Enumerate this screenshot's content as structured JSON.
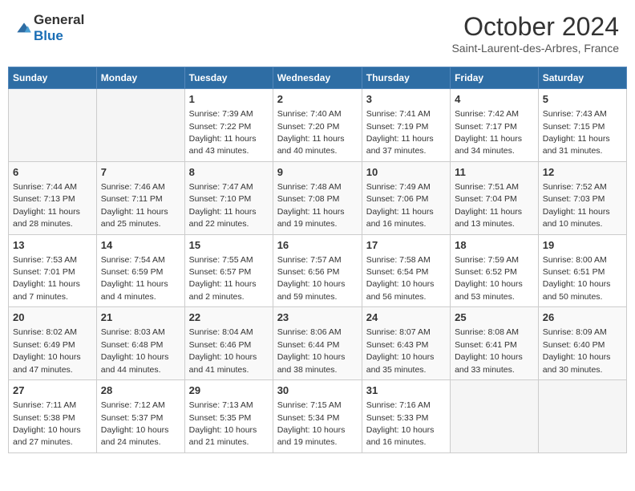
{
  "header": {
    "logo_general": "General",
    "logo_blue": "Blue",
    "month_title": "October 2024",
    "location": "Saint-Laurent-des-Arbres, France"
  },
  "weekdays": [
    "Sunday",
    "Monday",
    "Tuesday",
    "Wednesday",
    "Thursday",
    "Friday",
    "Saturday"
  ],
  "weeks": [
    [
      {
        "day": "",
        "empty": true
      },
      {
        "day": "",
        "empty": true
      },
      {
        "day": "1",
        "sunrise": "7:39 AM",
        "sunset": "7:22 PM",
        "daylight": "11 hours and 43 minutes."
      },
      {
        "day": "2",
        "sunrise": "7:40 AM",
        "sunset": "7:20 PM",
        "daylight": "11 hours and 40 minutes."
      },
      {
        "day": "3",
        "sunrise": "7:41 AM",
        "sunset": "7:19 PM",
        "daylight": "11 hours and 37 minutes."
      },
      {
        "day": "4",
        "sunrise": "7:42 AM",
        "sunset": "7:17 PM",
        "daylight": "11 hours and 34 minutes."
      },
      {
        "day": "5",
        "sunrise": "7:43 AM",
        "sunset": "7:15 PM",
        "daylight": "11 hours and 31 minutes."
      }
    ],
    [
      {
        "day": "6",
        "sunrise": "7:44 AM",
        "sunset": "7:13 PM",
        "daylight": "11 hours and 28 minutes."
      },
      {
        "day": "7",
        "sunrise": "7:46 AM",
        "sunset": "7:11 PM",
        "daylight": "11 hours and 25 minutes."
      },
      {
        "day": "8",
        "sunrise": "7:47 AM",
        "sunset": "7:10 PM",
        "daylight": "11 hours and 22 minutes."
      },
      {
        "day": "9",
        "sunrise": "7:48 AM",
        "sunset": "7:08 PM",
        "daylight": "11 hours and 19 minutes."
      },
      {
        "day": "10",
        "sunrise": "7:49 AM",
        "sunset": "7:06 PM",
        "daylight": "11 hours and 16 minutes."
      },
      {
        "day": "11",
        "sunrise": "7:51 AM",
        "sunset": "7:04 PM",
        "daylight": "11 hours and 13 minutes."
      },
      {
        "day": "12",
        "sunrise": "7:52 AM",
        "sunset": "7:03 PM",
        "daylight": "11 hours and 10 minutes."
      }
    ],
    [
      {
        "day": "13",
        "sunrise": "7:53 AM",
        "sunset": "7:01 PM",
        "daylight": "11 hours and 7 minutes."
      },
      {
        "day": "14",
        "sunrise": "7:54 AM",
        "sunset": "6:59 PM",
        "daylight": "11 hours and 4 minutes."
      },
      {
        "day": "15",
        "sunrise": "7:55 AM",
        "sunset": "6:57 PM",
        "daylight": "11 hours and 2 minutes."
      },
      {
        "day": "16",
        "sunrise": "7:57 AM",
        "sunset": "6:56 PM",
        "daylight": "10 hours and 59 minutes."
      },
      {
        "day": "17",
        "sunrise": "7:58 AM",
        "sunset": "6:54 PM",
        "daylight": "10 hours and 56 minutes."
      },
      {
        "day": "18",
        "sunrise": "7:59 AM",
        "sunset": "6:52 PM",
        "daylight": "10 hours and 53 minutes."
      },
      {
        "day": "19",
        "sunrise": "8:00 AM",
        "sunset": "6:51 PM",
        "daylight": "10 hours and 50 minutes."
      }
    ],
    [
      {
        "day": "20",
        "sunrise": "8:02 AM",
        "sunset": "6:49 PM",
        "daylight": "10 hours and 47 minutes."
      },
      {
        "day": "21",
        "sunrise": "8:03 AM",
        "sunset": "6:48 PM",
        "daylight": "10 hours and 44 minutes."
      },
      {
        "day": "22",
        "sunrise": "8:04 AM",
        "sunset": "6:46 PM",
        "daylight": "10 hours and 41 minutes."
      },
      {
        "day": "23",
        "sunrise": "8:06 AM",
        "sunset": "6:44 PM",
        "daylight": "10 hours and 38 minutes."
      },
      {
        "day": "24",
        "sunrise": "8:07 AM",
        "sunset": "6:43 PM",
        "daylight": "10 hours and 35 minutes."
      },
      {
        "day": "25",
        "sunrise": "8:08 AM",
        "sunset": "6:41 PM",
        "daylight": "10 hours and 33 minutes."
      },
      {
        "day": "26",
        "sunrise": "8:09 AM",
        "sunset": "6:40 PM",
        "daylight": "10 hours and 30 minutes."
      }
    ],
    [
      {
        "day": "27",
        "sunrise": "7:11 AM",
        "sunset": "5:38 PM",
        "daylight": "10 hours and 27 minutes."
      },
      {
        "day": "28",
        "sunrise": "7:12 AM",
        "sunset": "5:37 PM",
        "daylight": "10 hours and 24 minutes."
      },
      {
        "day": "29",
        "sunrise": "7:13 AM",
        "sunset": "5:35 PM",
        "daylight": "10 hours and 21 minutes."
      },
      {
        "day": "30",
        "sunrise": "7:15 AM",
        "sunset": "5:34 PM",
        "daylight": "10 hours and 19 minutes."
      },
      {
        "day": "31",
        "sunrise": "7:16 AM",
        "sunset": "5:33 PM",
        "daylight": "10 hours and 16 minutes."
      },
      {
        "day": "",
        "empty": true
      },
      {
        "day": "",
        "empty": true
      }
    ]
  ],
  "labels": {
    "sunrise": "Sunrise:",
    "sunset": "Sunset:",
    "daylight": "Daylight:"
  }
}
